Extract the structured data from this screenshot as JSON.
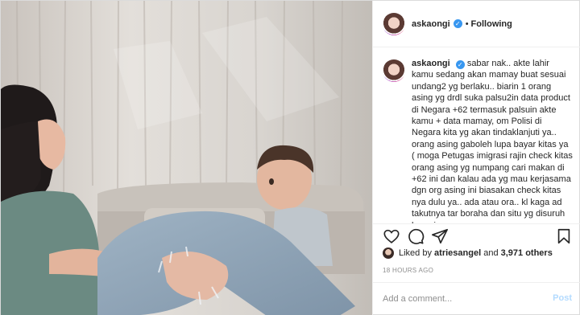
{
  "post": {
    "username": "askaongi",
    "verified_icon": "verified-badge-icon",
    "separator": "•",
    "follow_status": "Following"
  },
  "caption": {
    "username": "askaongi",
    "text": "sabar nak.. akte lahir kamu sedang akan mamay buat sesuai undang2 yg berlaku.. biarin 1 orang asing yg drdl suka palsu2in data product di Negara +62 termasuk palsuin akte kamu + data mamay, om Polisi di Negara kita yg akan tindaklanjuti ya.. orang asing gaboleh lupa bayar kitas ya ( moga Petugas imigrasi rajin check kitas orang asing yg numpang cari makan di +62 ini dan kalau ada yg mau kerjasama dgn org asing ini biasakan check kitas nya dulu ya.. ada atau ora.. kl kaga ad takutnya tar boraha dan situ yg disuruh bayarin"
  },
  "actions": {
    "like_icon": "heart-icon",
    "comment_icon": "comment-icon",
    "share_icon": "share-icon",
    "save_icon": "bookmark-icon"
  },
  "likes": {
    "prefix": "Liked by",
    "user": "atriesangel",
    "and": "and",
    "count": "3,971 others"
  },
  "timestamp": "18 HOURS AGO",
  "comment": {
    "placeholder": "Add a comment...",
    "post_label": "Post"
  },
  "colors": {
    "verified": "#3897f0",
    "post_button_disabled": "#b3dbff",
    "muted_text": "#8e8e8e",
    "border": "#dbdbdb"
  }
}
